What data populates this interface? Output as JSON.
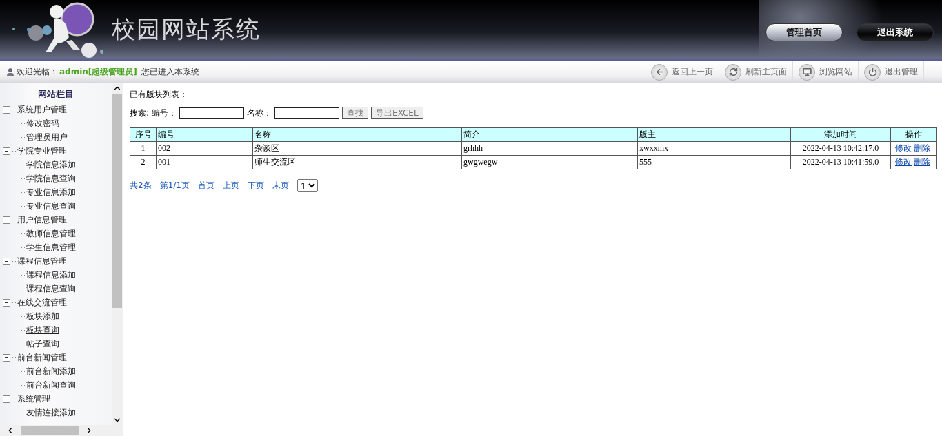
{
  "header": {
    "title": "校园网站系统",
    "buttons": [
      {
        "label": "管理首页",
        "kind": "light"
      },
      {
        "label": "退出系统",
        "kind": "dark"
      }
    ]
  },
  "welcome": {
    "prefix": "欢迎光临：",
    "user": "admin[超级管理员]",
    "suffix": "您已进入本系统"
  },
  "toolbar": [
    {
      "label": "返回上一页",
      "kind": "back"
    },
    {
      "label": "刷新主页面",
      "kind": "refresh"
    },
    {
      "label": "浏览网站",
      "kind": "browse"
    },
    {
      "label": "退出管理",
      "kind": "power"
    }
  ],
  "sidebar": {
    "title": "网站栏目",
    "groups": [
      {
        "label": "系统用户管理",
        "expanded": true,
        "children": [
          {
            "label": "修改密码",
            "selected": false
          },
          {
            "label": "管理员用户",
            "selected": false
          }
        ]
      },
      {
        "label": "学院专业管理",
        "expanded": true,
        "children": [
          {
            "label": "学院信息添加",
            "selected": false
          },
          {
            "label": "学院信息查询",
            "selected": false
          },
          {
            "label": "专业信息添加",
            "selected": false
          },
          {
            "label": "专业信息查询",
            "selected": false
          }
        ]
      },
      {
        "label": "用户信息管理",
        "expanded": true,
        "children": [
          {
            "label": "教师信息管理",
            "selected": false
          },
          {
            "label": "学生信息管理",
            "selected": false
          }
        ]
      },
      {
        "label": "课程信息管理",
        "expanded": true,
        "children": [
          {
            "label": "课程信息添加",
            "selected": false
          },
          {
            "label": "课程信息查询",
            "selected": false
          }
        ]
      },
      {
        "label": "在线交流管理",
        "expanded": true,
        "children": [
          {
            "label": "板块添加",
            "selected": false
          },
          {
            "label": "板块查询",
            "selected": true
          },
          {
            "label": "帖子查询",
            "selected": false
          }
        ]
      },
      {
        "label": "前台新闻管理",
        "expanded": true,
        "children": [
          {
            "label": "前台新闻添加",
            "selected": false
          },
          {
            "label": "前台新闻查询",
            "selected": false
          }
        ]
      },
      {
        "label": "系统管理",
        "expanded": true,
        "children": [
          {
            "label": "友情连接添加",
            "selected": false
          }
        ]
      }
    ]
  },
  "content": {
    "heading": "已有版块列表：",
    "search": {
      "label": "搜索:",
      "fields": [
        {
          "label": "编号："
        },
        {
          "label": "名称："
        }
      ],
      "buttons": [
        "查找",
        "导出EXCEL"
      ]
    },
    "table": {
      "columns": [
        "序号",
        "编号",
        "名称",
        "简介",
        "版主",
        "添加时间",
        "操作"
      ],
      "rows": [
        {
          "cells": [
            "1",
            "002",
            "杂谈区",
            "grhhh",
            "xwxxmx",
            "2022-04-13 10:42:17.0"
          ],
          "actions": [
            "修改",
            "删除"
          ]
        },
        {
          "cells": [
            "2",
            "001",
            "师生交流区",
            "gwgwegw",
            "555",
            "2022-04-13 10:41:59.0"
          ],
          "actions": [
            "修改",
            "删除"
          ]
        }
      ]
    },
    "pagination": {
      "links": [
        "共2条",
        "第1/1页",
        "首页",
        "上页",
        "下页",
        "末页"
      ],
      "page": "1"
    }
  }
}
